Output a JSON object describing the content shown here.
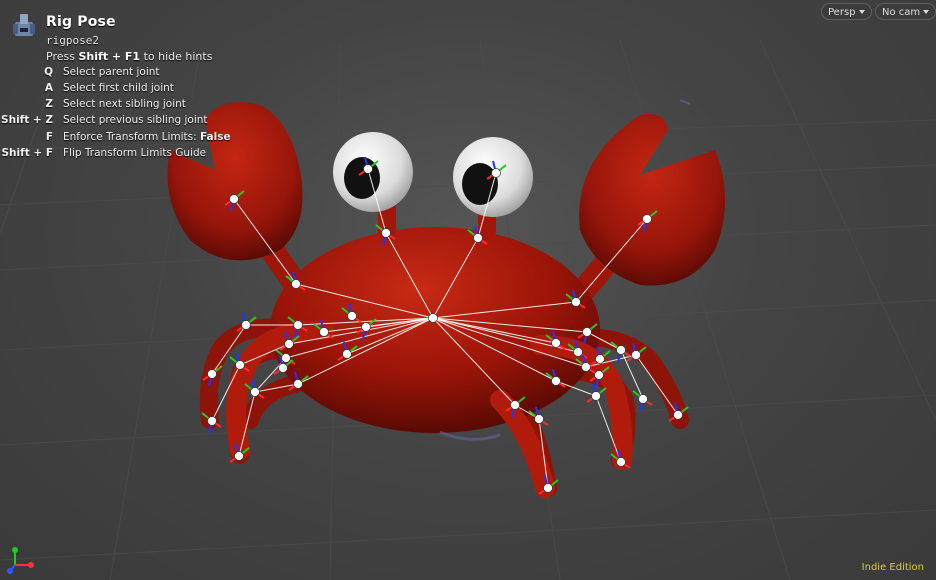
{
  "tool": {
    "title": "Rig Pose",
    "node": "rigpose2",
    "hint_prefix": "Press ",
    "hint_key": "Shift + F1",
    "hint_suffix": " to hide hints",
    "icon": "rig-pose-tool-icon"
  },
  "hotkeys": [
    {
      "key": "Q",
      "desc": "Select parent joint"
    },
    {
      "key": "A",
      "desc": "Select first child joint"
    },
    {
      "key": "Z",
      "desc": "Select next sibling joint"
    },
    {
      "key": "Shift + Z",
      "desc": "Select previous sibling joint"
    },
    {
      "key": "F",
      "desc": "Enforce Transform Limits:",
      "value": "False"
    },
    {
      "key": "Shift + F",
      "desc": "Flip Transform Limits Guide"
    }
  ],
  "viewport": {
    "camera_menu": "Persp",
    "cam_menu": "No cam",
    "edition": "Indie Edition",
    "colors": {
      "crab_body": "#a8170a",
      "crab_shadow": "#5a0a04",
      "eye_white": "#e2e2e2",
      "pupil": "#111111",
      "joint": "#ffffff",
      "bone": "#ffffff",
      "axis_x": "#ff2a2a",
      "axis_y": "#22cc22",
      "axis_z": "#2233ff",
      "edition_text": "#d6cf30"
    }
  }
}
